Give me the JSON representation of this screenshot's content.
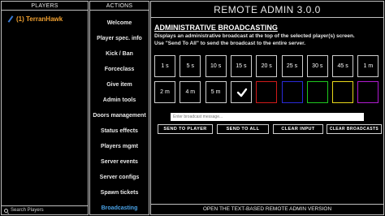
{
  "players_panel": {
    "header": "PLAYERS",
    "player_label": "(1) TerranHawk",
    "search_placeholder": "Search Players"
  },
  "actions_panel": {
    "header": "ACTIONS",
    "items": [
      {
        "label": "Welcome",
        "active": false
      },
      {
        "label": "Player spec. info",
        "active": false
      },
      {
        "label": "Kick / Ban",
        "active": false
      },
      {
        "label": "Forceclass",
        "active": false
      },
      {
        "label": "Give item",
        "active": false
      },
      {
        "label": "Admin tools",
        "active": false
      },
      {
        "label": "Doors management",
        "active": false
      },
      {
        "label": "Status effects",
        "active": false
      },
      {
        "label": "Players mgmt",
        "active": false
      },
      {
        "label": "Server events",
        "active": false
      },
      {
        "label": "Server configs",
        "active": false
      },
      {
        "label": "Spawn tickets",
        "active": false
      },
      {
        "label": "Broadcasting",
        "active": true
      }
    ]
  },
  "main": {
    "title": "REMOTE ADMIN 3.0.0",
    "section_title": "ADMINISTRATIVE BROADCASTING",
    "description_line1": "Displays an administrative broadcast at the top of the selected player(s) screen.",
    "description_line2": "Use \"Send To All\" to send the broadcast to the entire server.",
    "time_row1": [
      "1 s",
      "5 s",
      "10 s",
      "15 s",
      "20 s",
      "25 s",
      "30 s",
      "45 s",
      "1 m"
    ],
    "time_row2": [
      "2 m",
      "4 m",
      "5 m"
    ],
    "selected_icon": "checkmark-icon",
    "colors": [
      "#d01a1a",
      "#2a2ad8",
      "#1ec81e",
      "#e8d81a",
      "#b01ad0"
    ],
    "message_placeholder": "Enter broadcast message...",
    "buttons": {
      "send_player": "SEND TO PLAYER",
      "send_all": "SEND TO ALL",
      "clear_input": "CLEAR INPUT",
      "clear_broadcasts": "CLEAR BROADCASTS"
    },
    "footer": "OPEN THE TEXT-BASED REMOTE ADMIN VERSION"
  }
}
